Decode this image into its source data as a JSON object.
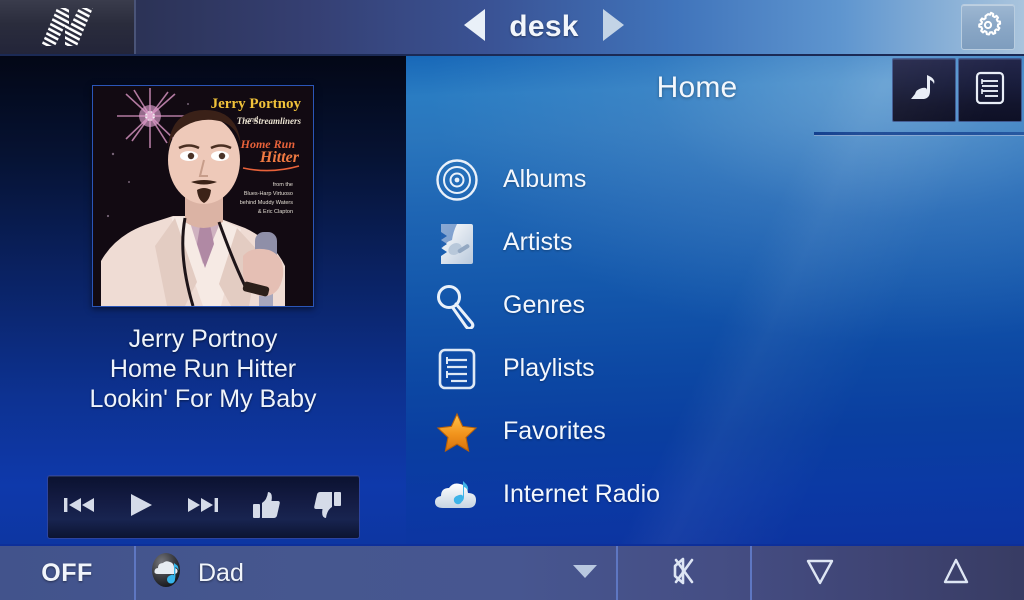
{
  "topbar": {
    "logo_icon": "brand-logo-striped-n",
    "prev_icon": "triangle-left-icon",
    "next_icon": "triangle-right-icon",
    "zone_name": "desk",
    "settings_icon": "gear-icon"
  },
  "now_playing": {
    "album_art": {
      "artist_line": "Jerry Portnoy",
      "and_line": "and",
      "band_line": "The Streamliners",
      "title_line1": "Home Run",
      "title_line2": "Hitter",
      "blurb": "from the Blues-Harp Virtuoso behind Muddy Waters & Eric Clapton"
    },
    "artist": "Jerry Portnoy",
    "album": "Home Run Hitter",
    "track": "Lookin' For My Baby",
    "transport": [
      {
        "name": "previous-track-button",
        "icon": "skip-previous-icon"
      },
      {
        "name": "play-button",
        "icon": "play-icon"
      },
      {
        "name": "next-track-button",
        "icon": "skip-next-icon"
      },
      {
        "name": "thumbs-up-button",
        "icon": "thumbs-up-icon"
      },
      {
        "name": "thumbs-down-button",
        "icon": "thumbs-down-icon"
      }
    ]
  },
  "browse": {
    "title": "Home",
    "header_buttons": [
      {
        "name": "now-playing-button",
        "icon": "music-note-icon"
      },
      {
        "name": "queue-button",
        "icon": "playlist-document-icon"
      }
    ],
    "menu": [
      {
        "label": "Albums",
        "icon": "disc-icon"
      },
      {
        "label": "Artists",
        "icon": "artist-silhouette-icon"
      },
      {
        "label": "Genres",
        "icon": "microphone-icon"
      },
      {
        "label": "Playlists",
        "icon": "playlist-document-icon"
      },
      {
        "label": "Favorites",
        "icon": "star-icon"
      },
      {
        "label": "Internet Radio",
        "icon": "cloud-music-icon"
      }
    ]
  },
  "bottombar": {
    "power_label": "OFF",
    "source_icon": "cloud-music-circle-icon",
    "source_name": "Dad",
    "dropdown_icon": "chevron-down-icon",
    "mute_icon": "speaker-mute-icon",
    "volume_down_icon": "triangle-down-icon",
    "volume_up_icon": "triangle-up-icon"
  },
  "colors": {
    "accent_blue": "#1868b8",
    "panel_dark_blue": "#0a2263",
    "bottom_bar": "#46578f",
    "favorite_star": "#f0931e",
    "text": "#f1f5fb"
  }
}
